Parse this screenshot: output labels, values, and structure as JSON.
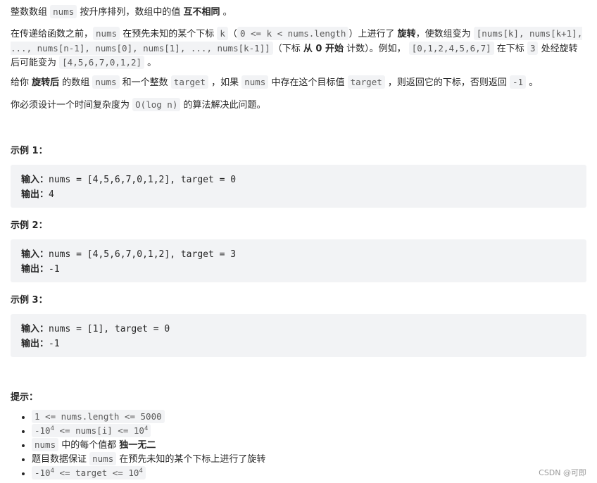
{
  "paragraphs": [
    [
      {
        "t": "整数数组 "
      },
      {
        "c": "nums"
      },
      {
        "t": " 按升序排列，数组中的值 "
      },
      {
        "b": "互不相同"
      },
      {
        "t": " 。"
      }
    ],
    [
      {
        "t": "在传递给函数之前，"
      },
      {
        "c": "nums"
      },
      {
        "t": " 在预先未知的某个下标 "
      },
      {
        "c": "k"
      },
      {
        "t": "（"
      },
      {
        "c": "0 <= k < nums.length"
      },
      {
        "t": "）上进行了 "
      },
      {
        "b": "旋转"
      },
      {
        "t": "，使数组变为 "
      },
      {
        "c": "[nums[k], nums[k+1], ..., nums[n-1], nums[0], nums[1], ..., nums[k-1]]"
      },
      {
        "t": "（下标 "
      },
      {
        "b": "从 0 开始"
      },
      {
        "t": " 计数）。例如， "
      },
      {
        "c": "[0,1,2,4,5,6,7]"
      },
      {
        "t": " 在下标 "
      },
      {
        "c": "3"
      },
      {
        "t": " 处经旋转后可能变为 "
      },
      {
        "c": "[4,5,6,7,0,1,2]"
      },
      {
        "t": " 。"
      }
    ],
    [
      {
        "t": "给你 "
      },
      {
        "b": "旋转后"
      },
      {
        "t": " 的数组 "
      },
      {
        "c": "nums"
      },
      {
        "t": " 和一个整数 "
      },
      {
        "c": "target"
      },
      {
        "t": " ，如果 "
      },
      {
        "c": "nums"
      },
      {
        "t": " 中存在这个目标值 "
      },
      {
        "c": "target"
      },
      {
        "t": " ，则返回它的下标，否则返回 "
      },
      {
        "c": "-1"
      },
      {
        "t": " 。"
      }
    ],
    [
      {
        "t": "你必须设计一个时间复杂度为 "
      },
      {
        "c": "O(log n)"
      },
      {
        "t": " 的算法解决此问题。"
      }
    ]
  ],
  "examples": [
    {
      "title": "示例 1：",
      "input_label": "输入：",
      "input": "nums = [4,5,6,7,0,1,2], target = 0",
      "output_label": "输出：",
      "output": "4"
    },
    {
      "title": "示例 2：",
      "input_label": "输入：",
      "input": "nums = [4,5,6,7,0,1,2], target = 3",
      "output_label": "输出：",
      "output": "-1"
    },
    {
      "title": "示例 3：",
      "input_label": "输入：",
      "input": "nums = [1], target = 0",
      "output_label": "输出：",
      "output": "-1"
    }
  ],
  "hints_title": "提示：",
  "hints": [
    [
      {
        "c": "1 <= nums.length <= 5000"
      }
    ],
    [
      {
        "c": "-10",
        "sup": "4",
        "c2": " <= nums[i] <= 10",
        "sup2": "4"
      }
    ],
    [
      {
        "c": "nums"
      },
      {
        "t": " 中的每个值都 "
      },
      {
        "b": "独一无二"
      }
    ],
    [
      {
        "t": "题目数据保证 "
      },
      {
        "c": "nums"
      },
      {
        "t": " 在预先未知的某个下标上进行了旋转"
      }
    ],
    [
      {
        "c": "-10",
        "sup": "4",
        "c2": " <= target <= 10",
        "sup2": "4"
      }
    ]
  ],
  "watermark": "CSDN @可即"
}
